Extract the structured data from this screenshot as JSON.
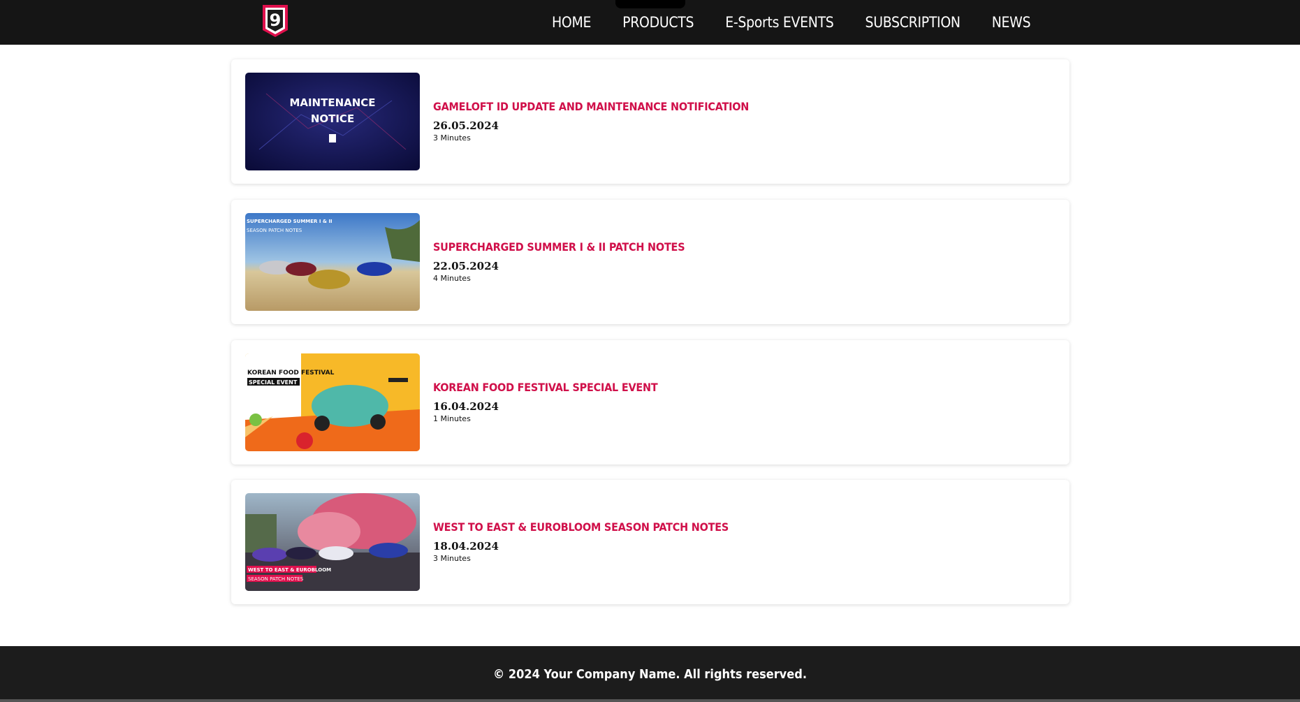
{
  "header": {
    "logo_alt": "Asphalt 9 logo",
    "nav": [
      "HOME",
      "PRODUCTS",
      "E-Sports EVENTS",
      "SUBSCRIPTION",
      "NEWS"
    ]
  },
  "news": [
    {
      "title": "GAMELOFT ID UPDATE AND MAINTENANCE NOTIFICATION",
      "date": "26.05.2024",
      "read_time": "3 Minutes",
      "thumb_text": [
        "MAINTENANCE",
        "NOTICE"
      ]
    },
    {
      "title": "SUPERCHARGED SUMMER I & II PATCH NOTES",
      "date": "22.05.2024",
      "read_time": "4 Minutes",
      "thumb_text": [
        "SUPERCHARGED SUMMER I & II",
        "SEASON PATCH NOTES"
      ]
    },
    {
      "title": "KOREAN FOOD FESTIVAL SPECIAL EVENT",
      "date": "16.04.2024",
      "read_time": "1 Minutes",
      "thumb_text": [
        "KOREAN FOOD FESTIVAL",
        "SPECIAL EVENT"
      ]
    },
    {
      "title": "WEST TO EAST & EUROBLOOM SEASON PATCH NOTES",
      "date": "18.04.2024",
      "read_time": "3 Minutes",
      "thumb_text": [
        "WEST TO EAST & EUROBLOOM",
        "SEASON PATCH NOTES"
      ]
    }
  ],
  "footer": {
    "copyright": "© 2024 Your Company Name. All rights reserved."
  },
  "colors": {
    "accent": "#d0104a",
    "header_bg": "#151515",
    "footer_bg": "#1c1c1c"
  }
}
